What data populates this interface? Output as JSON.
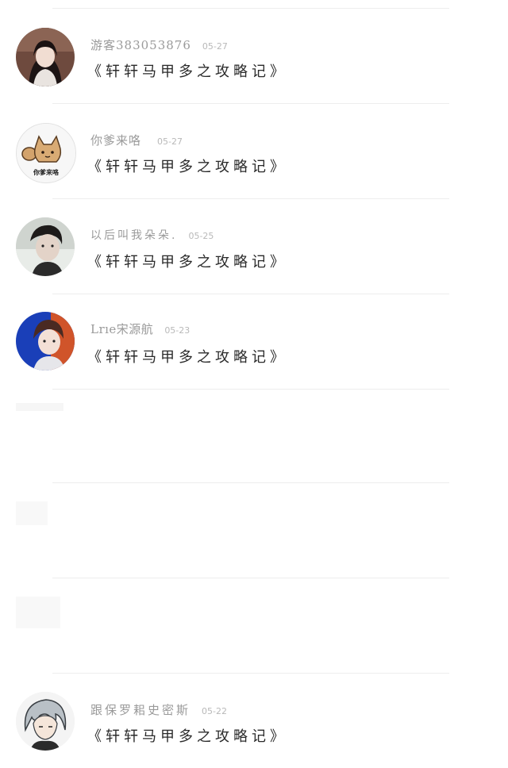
{
  "comments": [
    {
      "username": "游客383053876",
      "date": "05-27",
      "text": "《轩轩马甲多之攻略记》",
      "avatar": "avatar-girl-dark-hair-icon"
    },
    {
      "username": "你爹来咯",
      "date": "05-27",
      "text": "《轩轩马甲多之攻略记》",
      "avatar": "avatar-cartoon-cat-icon"
    },
    {
      "username": "以后叫我朵朵.",
      "date": "05-25",
      "text": "《轩轩马甲多之攻略记》",
      "avatar": "avatar-boy-photo-icon"
    },
    {
      "username": "Lrıe宋源航",
      "date": "05-23",
      "text": "《轩轩马甲多之攻略记》",
      "avatar": "avatar-boy-blue-bg-icon"
    },
    {
      "username": "跟保罗耜史密斯",
      "date": "05-22",
      "text": "《轩轩马甲多之攻略记》",
      "avatar": "avatar-anime-grey-hair-icon"
    }
  ],
  "avatar_text": "你爹来咯"
}
